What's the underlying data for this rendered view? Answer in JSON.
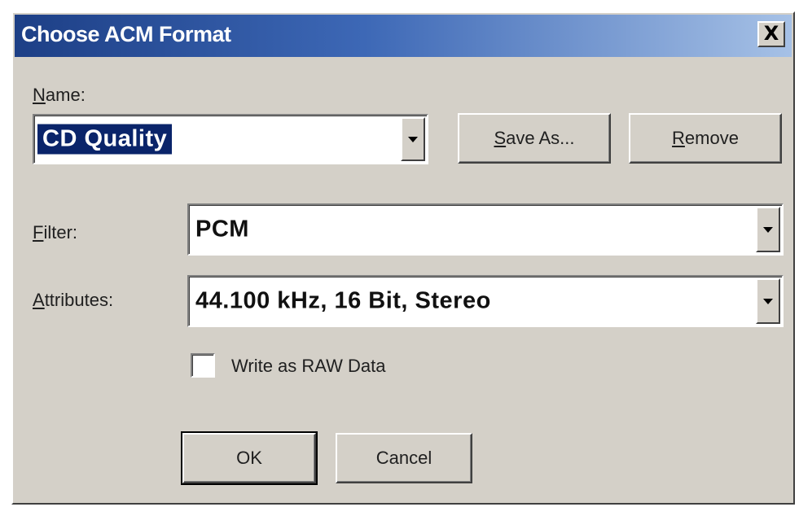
{
  "dialog": {
    "title": "Choose ACM Format",
    "close_label": "X"
  },
  "name_field": {
    "label_first": "N",
    "label_rest": "ame:",
    "value": "CD Quality"
  },
  "buttons": {
    "save_as_first": "S",
    "save_as_rest": "ave As...",
    "remove_first": "R",
    "remove_rest": "emove",
    "ok": "OK",
    "cancel": "Cancel"
  },
  "filter_field": {
    "label_first": "F",
    "label_rest": "ilter:",
    "value": "PCM"
  },
  "attributes_field": {
    "label_first": "A",
    "label_rest": "ttributes:",
    "value": "44.100 kHz, 16 Bit, Stereo"
  },
  "raw_checkbox": {
    "label": "Write as RAW Data",
    "checked": false
  },
  "colors": {
    "title_gradient_start": "#1d3f86",
    "title_gradient_end": "#a6c1e6",
    "dialog_face": "#d4d0c8",
    "selection": "#0a246a"
  }
}
